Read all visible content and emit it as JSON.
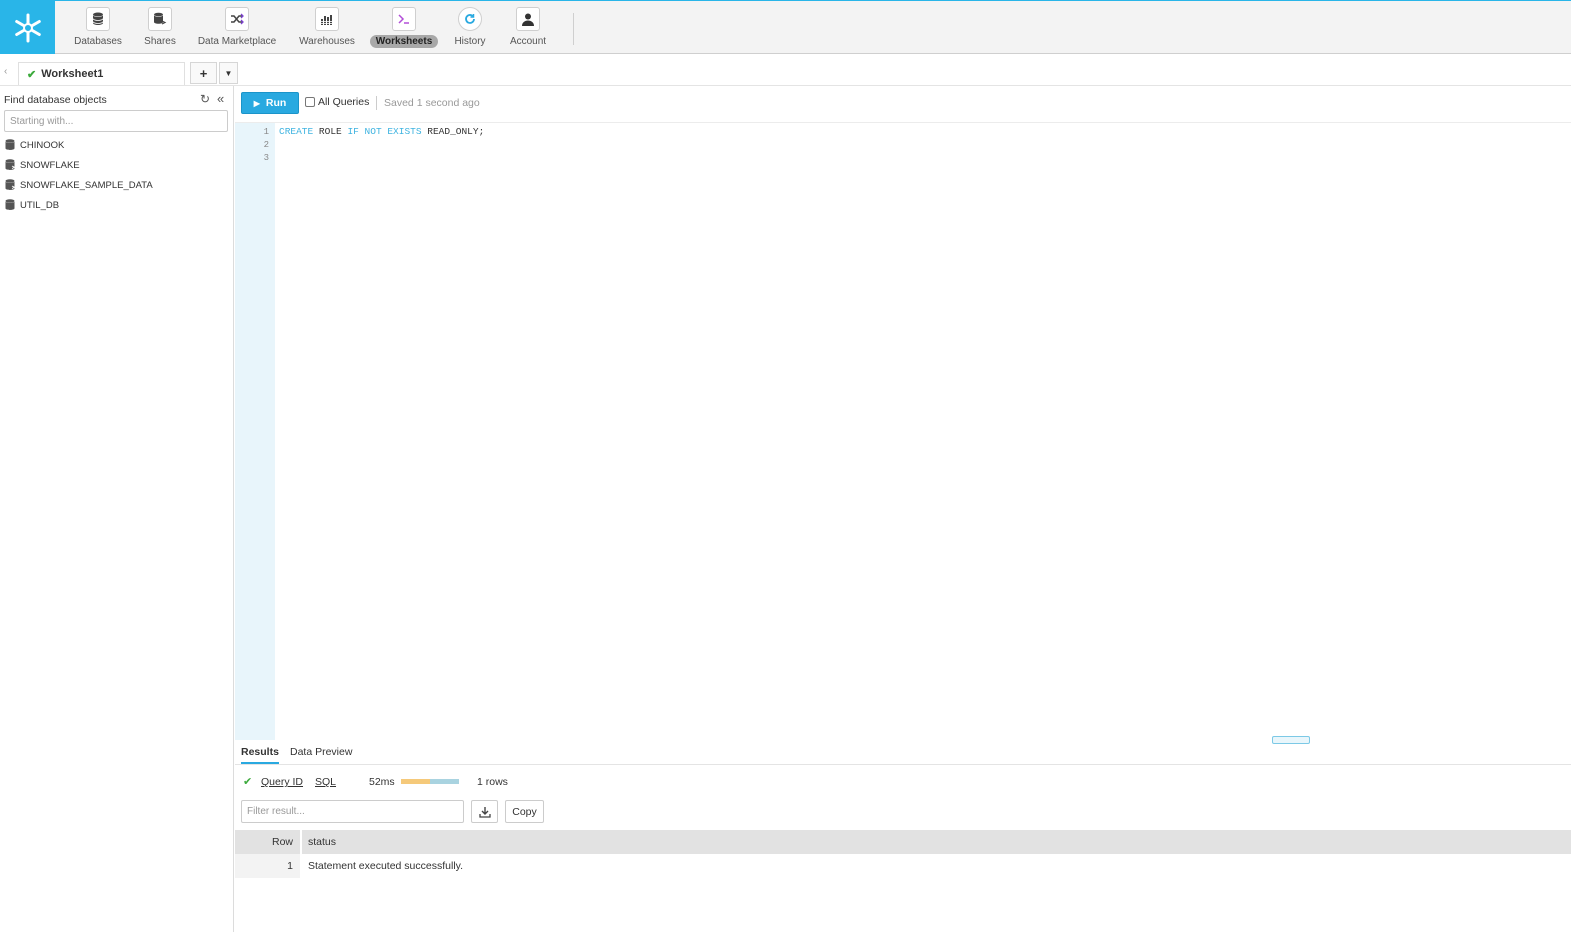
{
  "colors": {
    "brand": "#29b5e8",
    "run": "#29a9e0",
    "success": "#3caa3c"
  },
  "nav": [
    {
      "label": "Databases",
      "icon": "database-icon",
      "active": false
    },
    {
      "label": "Shares",
      "icon": "shares-icon",
      "active": false
    },
    {
      "label": "Data Marketplace",
      "icon": "marketplace-icon",
      "active": false
    },
    {
      "label": "Warehouses",
      "icon": "warehouse-icon",
      "active": false
    },
    {
      "label": "Worksheets",
      "icon": "terminal-icon",
      "active": true
    },
    {
      "label": "History",
      "icon": "history-icon",
      "active": false
    },
    {
      "label": "Account",
      "icon": "user-icon",
      "active": false
    }
  ],
  "tabs": {
    "worksheet": "Worksheet1"
  },
  "sidebar": {
    "title": "Find database objects",
    "search_placeholder": "Starting with...",
    "databases": [
      "CHINOOK",
      "SNOWFLAKE",
      "SNOWFLAKE_SAMPLE_DATA",
      "UTIL_DB"
    ]
  },
  "toolbar": {
    "run_label": "Run",
    "all_queries_label": "All Queries",
    "saved_status": "Saved 1 second ago"
  },
  "editor": {
    "line_numbers": [
      "1",
      "2",
      "3"
    ],
    "line1": {
      "kw1": "CREATE",
      "t1": " ROLE ",
      "kw2": "IF NOT EXISTS",
      "t2": " READ_ONLY;"
    }
  },
  "results": {
    "tabs": [
      "Results",
      "Data Preview"
    ],
    "query_id_label": "Query ID",
    "sql_label": "SQL",
    "duration": "52ms",
    "rows": "1 rows",
    "filter_placeholder": "Filter result...",
    "copy_label": "Copy",
    "columns": [
      "Row",
      "status"
    ],
    "data": [
      {
        "row": "1",
        "status": "Statement executed successfully."
      }
    ]
  }
}
